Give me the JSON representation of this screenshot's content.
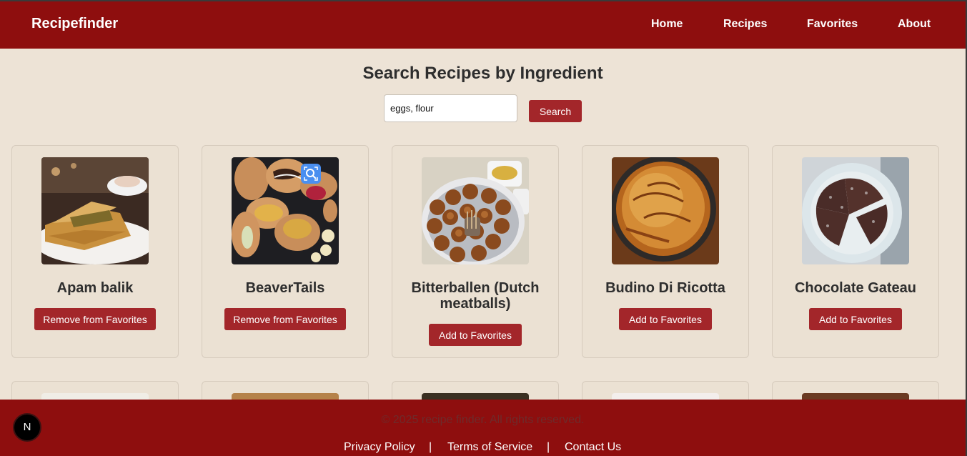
{
  "nav": {
    "brand": "Recipefinder",
    "links": [
      "Home",
      "Recipes",
      "Favorites",
      "About"
    ]
  },
  "search": {
    "title": "Search Recipes by Ingredient",
    "value": "eggs, flour",
    "button": "Search"
  },
  "recipes": [
    {
      "name": "Apam balik",
      "button": "Remove from Favorites"
    },
    {
      "name": "BeaverTails",
      "button": "Remove from Favorites"
    },
    {
      "name": "Bitterballen (Dutch meatballs)",
      "button": "Add to Favorites"
    },
    {
      "name": "Budino Di Ricotta",
      "button": "Add to Favorites"
    },
    {
      "name": "Chocolate Gateau",
      "button": "Add to Favorites"
    }
  ],
  "footer": {
    "copyright": "© 2025 recipe finder. All rights reserved.",
    "links": [
      "Privacy Policy",
      "Terms of Service",
      "Contact Us"
    ],
    "separator": "|"
  },
  "badge": "N",
  "colors": {
    "primary": "#8e0e0e",
    "button": "#a3262a",
    "background": "#ede3d6"
  }
}
